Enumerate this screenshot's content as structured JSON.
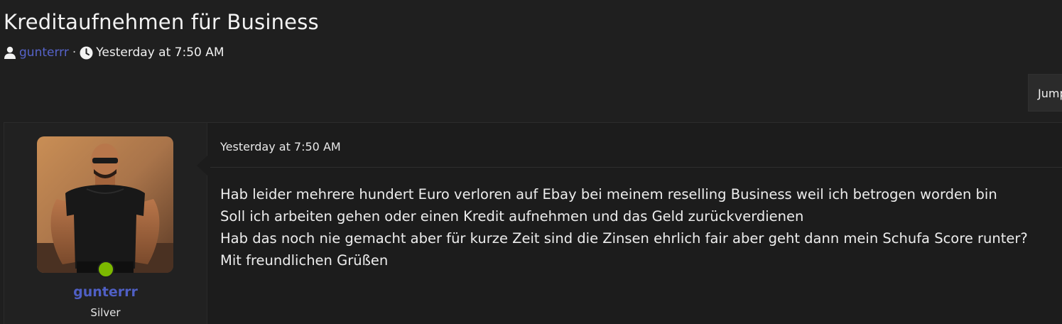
{
  "thread": {
    "title": "Kreditaufnehmen für Business",
    "author": "gunterrr",
    "separator": "·",
    "date": "Yesterday at 7:50 AM"
  },
  "toolbar": {
    "jump_label": "Jump"
  },
  "post": {
    "user": {
      "name": "gunterrr",
      "title": "Silver",
      "online": true
    },
    "date": "Yesterday at 7:50 AM",
    "lines": [
      "Hab leider mehrere hundert Euro verloren auf Ebay bei meinem reselling Business weil ich betrogen worden bin",
      "Soll ich arbeiten gehen oder einen Kredit aufnehmen und das Geld zurückverdienen",
      "Hab das noch nie gemacht aber für kurze Zeit sind die Zinsen ehrlich fair aber geht dann mein Schufa Score runter?",
      "Mit freundlichen Grüßen"
    ]
  },
  "icons": {
    "user": "user-icon",
    "clock": "clock-icon"
  },
  "colors": {
    "background": "#1f1f1f",
    "link": "#5663c9",
    "username": "#4f5fc4",
    "online": "#7cb800"
  }
}
